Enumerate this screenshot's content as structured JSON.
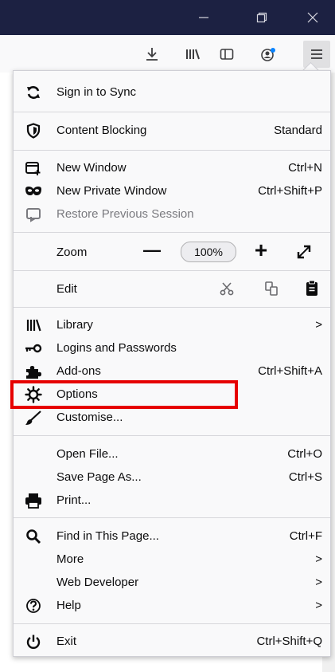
{
  "window": {
    "minimize_icon": "minimize-icon",
    "restore_icon": "restore-icon",
    "close_icon": "close-icon"
  },
  "toolbar": {
    "icons": [
      "download-icon",
      "library-icon",
      "sidebar-icon",
      "account-icon",
      "hamburger-menu-icon"
    ]
  },
  "menu": {
    "sync": {
      "label": "Sign in to Sync"
    },
    "content_blocking": {
      "label": "Content Blocking",
      "value": "Standard"
    },
    "new_window": {
      "label": "New Window",
      "shortcut": "Ctrl+N"
    },
    "new_private_window": {
      "label": "New Private Window",
      "shortcut": "Ctrl+Shift+P"
    },
    "restore_session": {
      "label": "Restore Previous Session"
    },
    "zoom": {
      "label": "Zoom",
      "minus": "—",
      "value": "100%",
      "plus": "+",
      "fullscreen_icon": "fullscreen-icon"
    },
    "edit": {
      "label": "Edit",
      "cut_icon": "cut-icon",
      "copy_icon": "copy-icon",
      "paste_icon": "paste-icon"
    },
    "library": {
      "label": "Library",
      "chevron": ">"
    },
    "logins": {
      "label": "Logins and Passwords"
    },
    "addons": {
      "label": "Add-ons",
      "shortcut": "Ctrl+Shift+A"
    },
    "options": {
      "label": "Options"
    },
    "customise": {
      "label": "Customise..."
    },
    "open_file": {
      "label": "Open File...",
      "shortcut": "Ctrl+O"
    },
    "save_page": {
      "label": "Save Page As...",
      "shortcut": "Ctrl+S"
    },
    "print": {
      "label": "Print..."
    },
    "find": {
      "label": "Find in This Page...",
      "shortcut": "Ctrl+F"
    },
    "more": {
      "label": "More",
      "chevron": ">"
    },
    "web_developer": {
      "label": "Web Developer",
      "chevron": ">"
    },
    "help": {
      "label": "Help",
      "chevron": ">"
    },
    "exit": {
      "label": "Exit",
      "shortcut": "Ctrl+Shift+Q"
    }
  },
  "colors": {
    "titlebar": "#1c2142",
    "menu_background": "#f9f9fa",
    "highlight_border": "#e60000"
  }
}
